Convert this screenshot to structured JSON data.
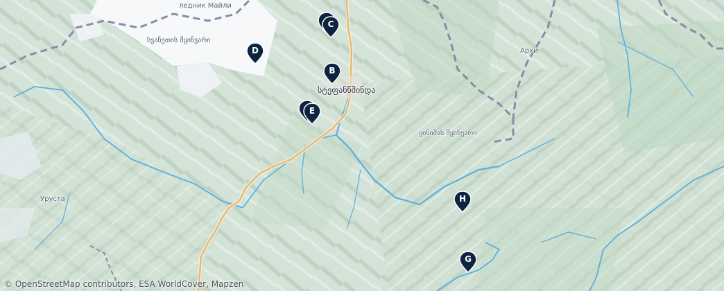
{
  "map": {
    "places": [
      {
        "id": "glacier-mayli",
        "label": "ледник Майли"
      },
      {
        "id": "svanetis-range",
        "label": "სვანეთის მყინვარი"
      },
      {
        "id": "stepantsminda",
        "label": "სტეფანწმინდა"
      },
      {
        "id": "arkhi",
        "label": "Архи"
      },
      {
        "id": "ukhus-range",
        "label": "ყინიშას მყინვარი"
      },
      {
        "id": "urusta",
        "label": "Уруста"
      }
    ],
    "markers": [
      {
        "letter": "C"
      },
      {
        "letter": "D"
      },
      {
        "letter": "B"
      },
      {
        "letter": "E"
      },
      {
        "letter": "H"
      },
      {
        "letter": "G"
      }
    ],
    "colors": {
      "terrain": "#d8e6dc",
      "snow": "#f6f8fa",
      "forest": "#bfd8c4",
      "river": "#5aaee0",
      "road": "#e8b86a",
      "border": "#8a8aa8",
      "marker": "#0d2440"
    }
  },
  "attribution": {
    "symbol": "©",
    "osm": "OpenStreetMap contributors",
    "sep": ", ",
    "esa": "ESA WorldCover",
    "mapzen": "Mapzen"
  }
}
